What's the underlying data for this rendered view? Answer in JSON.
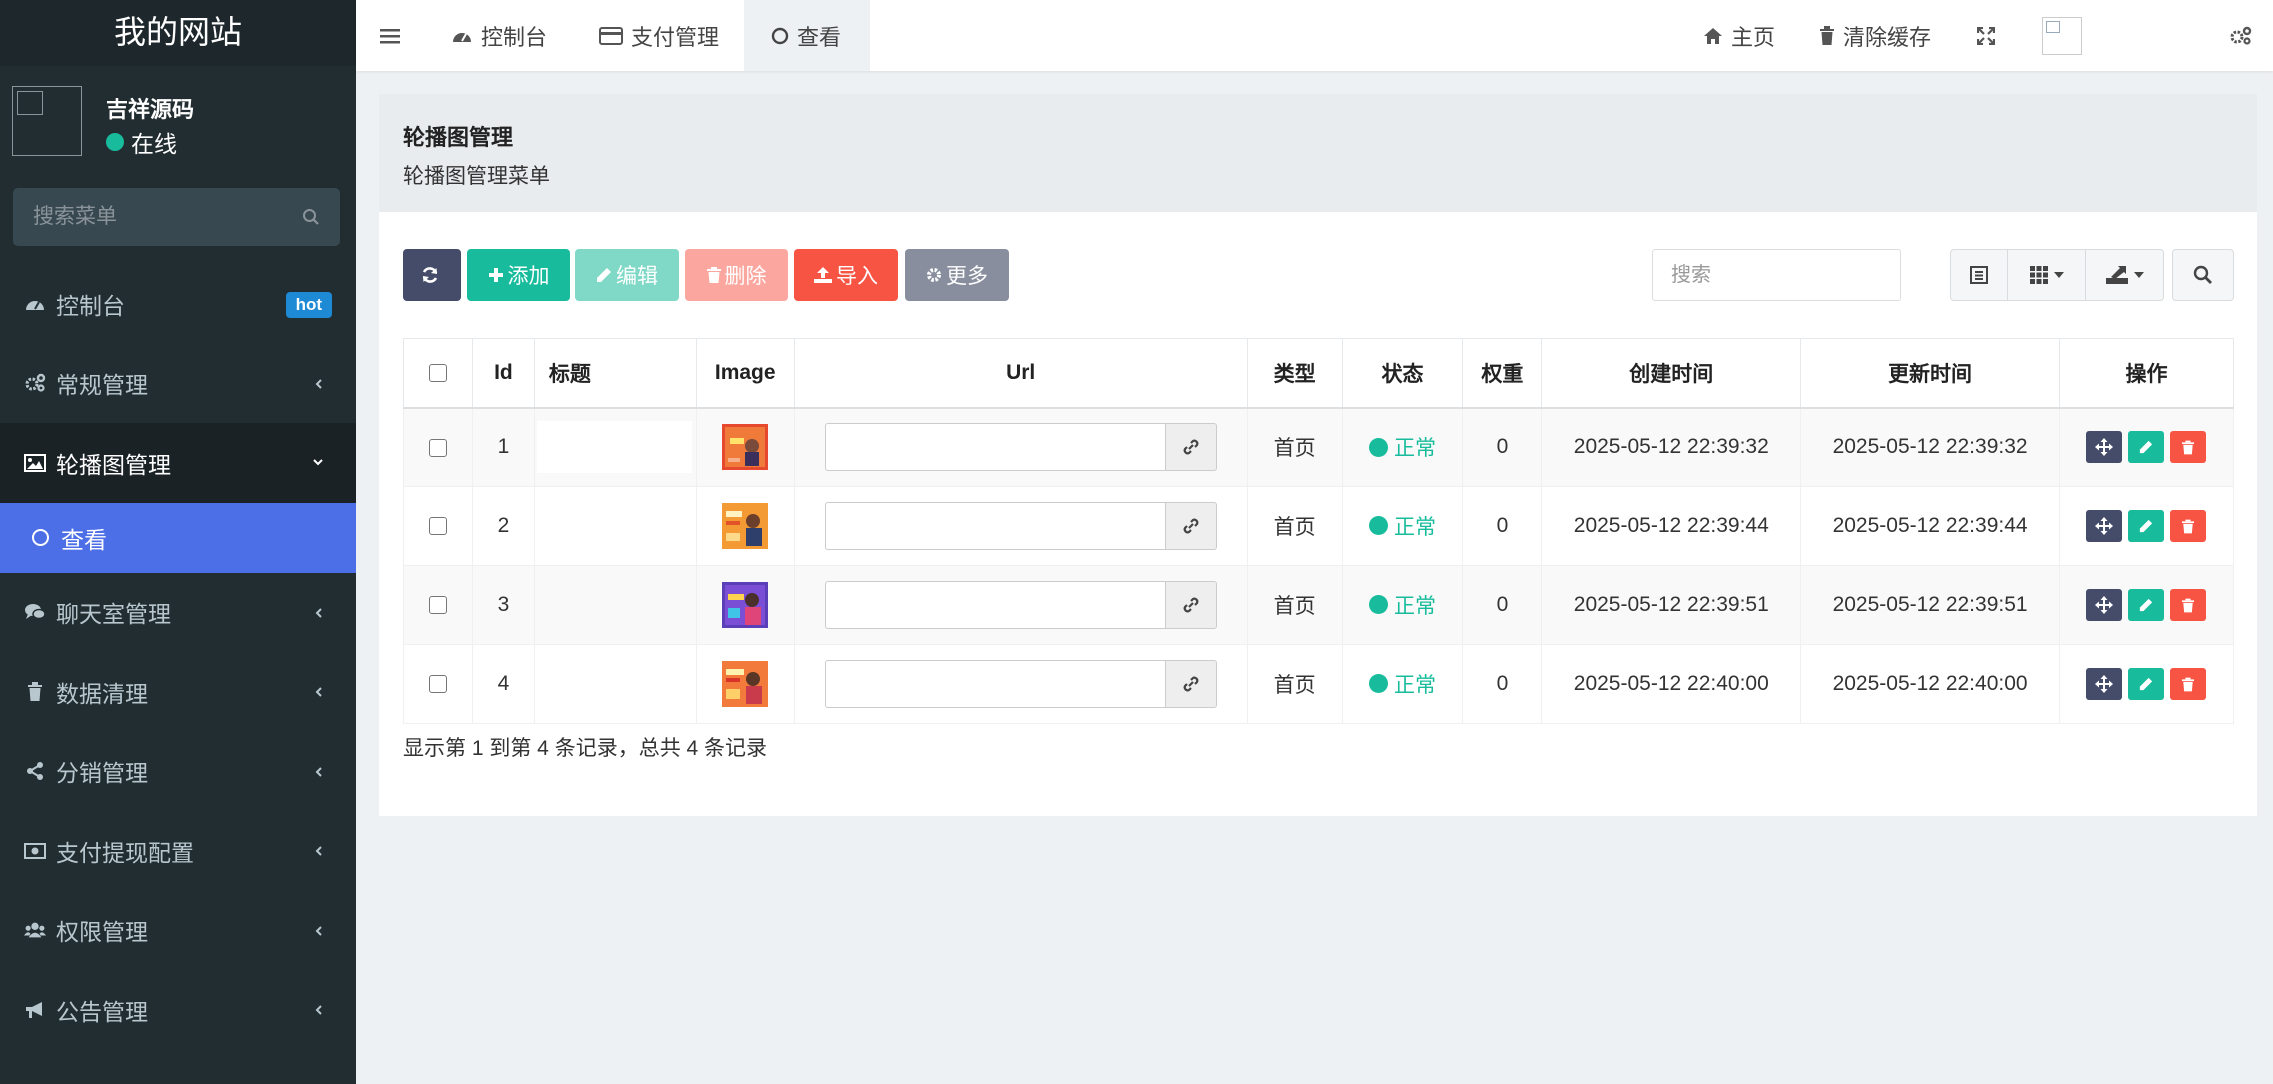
{
  "sidebar": {
    "site_title": "我的网站",
    "user_name": "吉祥源码",
    "user_status": "在线",
    "search_placeholder": "搜索菜单",
    "hot_badge": "hot",
    "items": [
      {
        "label": "控制台",
        "icon": "dashboard-icon"
      },
      {
        "label": "常规管理",
        "icon": "cogs-icon"
      },
      {
        "label": "轮播图管理",
        "icon": "image-icon"
      },
      {
        "label": "查看",
        "icon": "circle-icon"
      },
      {
        "label": "聊天室管理",
        "icon": "comments-icon"
      },
      {
        "label": "数据清理",
        "icon": "trash-icon"
      },
      {
        "label": "分销管理",
        "icon": "share-icon"
      },
      {
        "label": "支付提现配置",
        "icon": "money-icon"
      },
      {
        "label": "权限管理",
        "icon": "users-icon"
      },
      {
        "label": "公告管理",
        "icon": "bullhorn-icon"
      }
    ]
  },
  "topbar": {
    "tabs": [
      {
        "label": "控制台",
        "icon": "dashboard-icon"
      },
      {
        "label": "支付管理",
        "icon": "credit-card-icon"
      },
      {
        "label": "查看",
        "icon": "circle-icon"
      }
    ],
    "home_label": "主页",
    "clear_cache_label": "清除缓存"
  },
  "page": {
    "title": "轮播图管理",
    "subtitle": "轮播图管理菜单"
  },
  "toolbar": {
    "add": "添加",
    "edit": "编辑",
    "delete": "删除",
    "import": "导入",
    "more": "更多",
    "search_placeholder": "搜索"
  },
  "colors": {
    "sidebar_bg": "#222d32",
    "active_menu": "#4c6ee6",
    "primary": "#444c69",
    "success": "#18bc9c",
    "danger": "#f75444",
    "info": "#888e9e",
    "hot_badge": "#1e8ad6"
  },
  "table": {
    "columns": [
      "Id",
      "标题",
      "Image",
      "Url",
      "类型",
      "状态",
      "权重",
      "创建时间",
      "更新时间",
      "操作"
    ],
    "rows": [
      {
        "id": "1",
        "title": "",
        "url": "",
        "type": "首页",
        "status": "正常",
        "weight": "0",
        "created": "2025-05-12 22:39:32",
        "updated": "2025-05-12 22:39:32"
      },
      {
        "id": "2",
        "title": "",
        "url": "",
        "type": "首页",
        "status": "正常",
        "weight": "0",
        "created": "2025-05-12 22:39:44",
        "updated": "2025-05-12 22:39:44"
      },
      {
        "id": "3",
        "title": "",
        "url": "",
        "type": "首页",
        "status": "正常",
        "weight": "0",
        "created": "2025-05-12 22:39:51",
        "updated": "2025-05-12 22:39:51"
      },
      {
        "id": "4",
        "title": "",
        "url": "",
        "type": "首页",
        "status": "正常",
        "weight": "0",
        "created": "2025-05-12 22:40:00",
        "updated": "2025-05-12 22:40:00"
      }
    ],
    "footer": "显示第 1 到第 4 条记录，总共 4 条记录"
  }
}
